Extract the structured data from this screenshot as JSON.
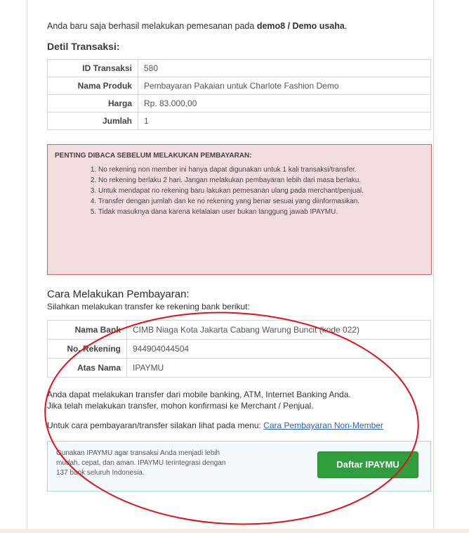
{
  "intro": {
    "prefix": "Anda baru saja berhasil melakukan pemesanan pada ",
    "merchant": "demo8 / Demo usaha",
    "suffix": "."
  },
  "detail_title": "Detil Transaksi:",
  "transaction": [
    {
      "label": "ID Transaksi",
      "value": "580"
    },
    {
      "label": "Nama Produk",
      "value": "Pembayaran Pakaian untuk Charlote Fashion Demo"
    },
    {
      "label": "Harga",
      "value": "Rp. 83.000,00"
    },
    {
      "label": "Jumlah",
      "value": "1"
    }
  ],
  "warning": {
    "title": "PENTING DIBACA SEBELUM MELAKUKAN PEMBAYARAN:",
    "items": [
      "No rekening non member ini hanya dapat digunakan untuk 1 kali transaksi/transfer.",
      "No rekening berlaku 2 hari. Jangan melakukan pembayaran lebih dari masa berlaku.",
      "Untuk mendapat no rekening baru lakukan pemesanan ulang pada merchant/penjual.",
      "Transfer dengan jumlah dan ke no rekening yang benar sesuai yang diinformasikan.",
      "Tidak masuknya dana karena kelalaian user bukan tanggung jawab IPAYMU."
    ]
  },
  "payment_title": "Cara Melakukan Pembayaran:",
  "payment_sub": "Silahkan melakukan transfer ke rekening bank berikut:",
  "bank": [
    {
      "label": "Nama Bank",
      "value": "CIMB Niaga Kota Jakarta Cabang Warung Buncit (kode 022)"
    },
    {
      "label": "No. Rekening",
      "value": "944904044504"
    },
    {
      "label": "Atas Nama",
      "value": "IPAYMU"
    }
  ],
  "transfer_info_1": "Anda dapat melakukan transfer dari mobile banking, ATM, Internet Banking Anda.",
  "transfer_info_2": "Jika telah melakukan transfer, mohon konfirmasi ke Merchant / Penjual.",
  "menu_prefix": "Untuk cara pembayaran/transfer silakan lihat pada menu: ",
  "menu_link": "Cara Pembayaran Non-Member",
  "promo_text": "Gunakan IPAYMU agar transaksi Anda menjadi lebih mudah, cepat, dan aman. IPAYMU terintegrasi dengan 137 bank seluruh Indonesia.",
  "promo_button": "Daftar IPAYMU",
  "colors": {
    "annotation": "#e3101a",
    "button": "#2f9e3c",
    "warning_bg": "#f2dede",
    "link": "#2a63b5"
  }
}
